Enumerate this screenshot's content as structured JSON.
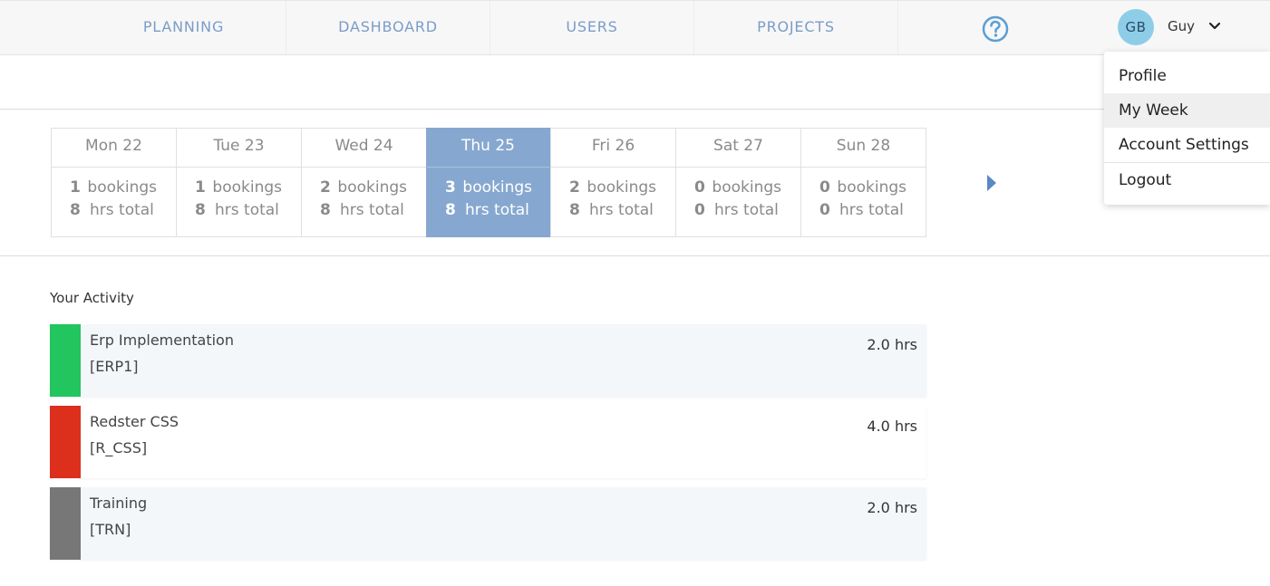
{
  "nav": {
    "items": [
      {
        "label": "PLANNING"
      },
      {
        "label": "DASHBOARD"
      },
      {
        "label": "USERS"
      },
      {
        "label": "PROJECTS"
      }
    ],
    "help_icon": "question-circle-icon",
    "user": {
      "initials": "GB",
      "name": "Guy",
      "menu_icon": "chevron-down-icon"
    }
  },
  "week": {
    "days": [
      {
        "label": "Mon 22",
        "bookings": "1",
        "bookings_label": "bookings",
        "hrs": "8",
        "hrs_label": "hrs total",
        "active": false
      },
      {
        "label": "Tue 23",
        "bookings": "1",
        "bookings_label": "bookings",
        "hrs": "8",
        "hrs_label": "hrs total",
        "active": false
      },
      {
        "label": "Wed 24",
        "bookings": "2",
        "bookings_label": "bookings",
        "hrs": "8",
        "hrs_label": "hrs total",
        "active": false
      },
      {
        "label": "Thu 25",
        "bookings": "3",
        "bookings_label": "bookings",
        "hrs": "8",
        "hrs_label": "hrs total",
        "active": true
      },
      {
        "label": "Fri 26",
        "bookings": "2",
        "bookings_label": "bookings",
        "hrs": "8",
        "hrs_label": "hrs total",
        "active": false
      },
      {
        "label": "Sat 27",
        "bookings": "0",
        "bookings_label": "bookings",
        "hrs": "0",
        "hrs_label": "hrs total",
        "active": false
      },
      {
        "label": "Sun 28",
        "bookings": "0",
        "bookings_label": "bookings",
        "hrs": "0",
        "hrs_label": "hrs total",
        "active": false
      }
    ],
    "next_icon": "caret-right-icon"
  },
  "activity": {
    "title": "Your Activity",
    "items": [
      {
        "name": "Erp Implementation",
        "code": "[ERP1]",
        "hours": "2.0 hrs",
        "color": "#22c55e"
      },
      {
        "name": "Redster CSS",
        "code": "[R_CSS]",
        "hours": "4.0 hrs",
        "color": "#dc2f1c"
      },
      {
        "name": "Training",
        "code": "[TRN]",
        "hours": "2.0 hrs",
        "color": "#777777"
      }
    ]
  },
  "user_menu": {
    "items": [
      {
        "label": "Profile"
      },
      {
        "label": "My Week"
      },
      {
        "label": "Account Settings"
      },
      {
        "label": "Logout"
      }
    ]
  },
  "colors": {
    "nav_text": "#7b9cc8",
    "active_day": "#86a8d0",
    "avatar_bg": "#8ecde8"
  }
}
